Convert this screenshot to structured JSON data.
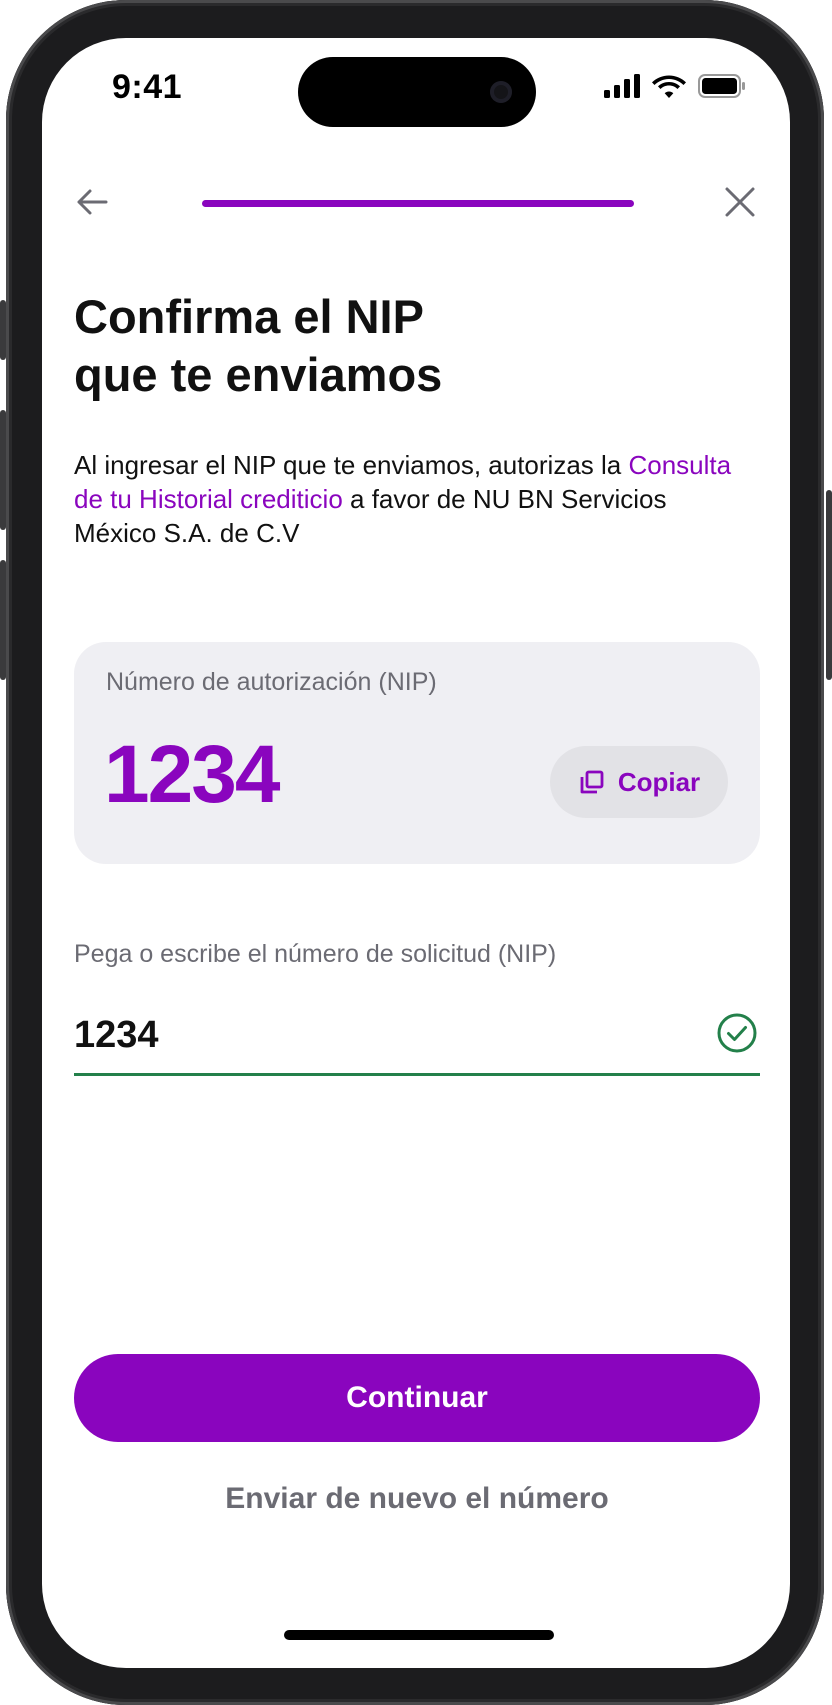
{
  "colors": {
    "brand": "#8a05be",
    "success": "#23804a",
    "muted_text": "#6b6b73",
    "card_bg": "#efeff3"
  },
  "status_bar": {
    "time": "9:41",
    "icons": [
      "cellular-signal-icon",
      "wifi-icon",
      "battery-icon"
    ]
  },
  "nav": {
    "back_icon": "arrow-left-icon",
    "close_icon": "close-icon",
    "progress": 1.0
  },
  "header": {
    "title_line1": "Confirma el NIP",
    "title_line2": "que te enviamos"
  },
  "description": {
    "part1": "Al ingresar el NIP que te enviamos, autorizas la",
    "link": "Consulta de tu Historial crediticio",
    "part2": "a favor de NU BN Servicios México S.A. de C.V"
  },
  "nip_card": {
    "label": "Número de autorización (NIP)",
    "value": "1234",
    "copy_label": "Copiar",
    "copy_icon": "copy-icon"
  },
  "nip_field": {
    "label": "Pega o escribe el número de solicitud (NIP)",
    "value": "1234",
    "status_icon": "check-circle-icon"
  },
  "actions": {
    "continue_label": "Continuar",
    "resend_label": "Enviar de nuevo el número"
  }
}
